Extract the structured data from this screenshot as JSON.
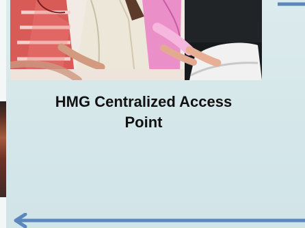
{
  "title_line1": "HMG Centralized Access",
  "title_line2": "Point",
  "colors": {
    "panel_background": "#d6e6eb",
    "arrow": "#5b87bd",
    "title_text": "#111111"
  }
}
